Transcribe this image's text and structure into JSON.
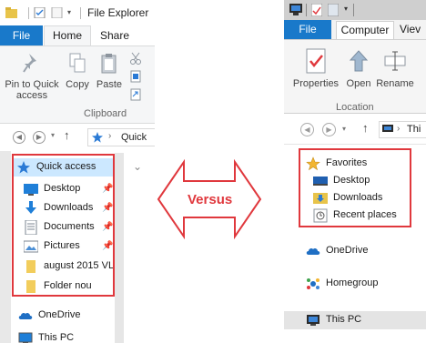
{
  "left": {
    "title": "File Explorer",
    "tabs": {
      "file": "File",
      "home": "Home",
      "share": "Share"
    },
    "ribbon": {
      "pin_label_1": "Pin to Quick",
      "pin_label_2": "access",
      "copy": "Copy",
      "paste": "Paste",
      "group": "Clipboard"
    },
    "address": "Quick",
    "nav": {
      "quick_access": "Quick access",
      "items": [
        "Desktop",
        "Downloads",
        "Documents",
        "Pictures",
        "august 2015 VL",
        "Folder nou"
      ],
      "onedrive": "OneDrive",
      "thispc": "This PC"
    }
  },
  "middle": {
    "versus": "Versus"
  },
  "right": {
    "tabs": {
      "file": "File",
      "computer": "Computer",
      "view": "Viev"
    },
    "ribbon": {
      "properties": "Properties",
      "open": "Open",
      "rename": "Rename",
      "group": "Location"
    },
    "address": "Thi",
    "nav": {
      "favorites": "Favorites",
      "items": [
        "Desktop",
        "Downloads",
        "Recent places"
      ],
      "onedrive": "OneDrive",
      "homegroup": "Homegroup",
      "thispc": "This PC"
    }
  },
  "colors": {
    "accent": "#1979ca",
    "highlight": "#e0383d",
    "selection": "#cce8ff"
  }
}
